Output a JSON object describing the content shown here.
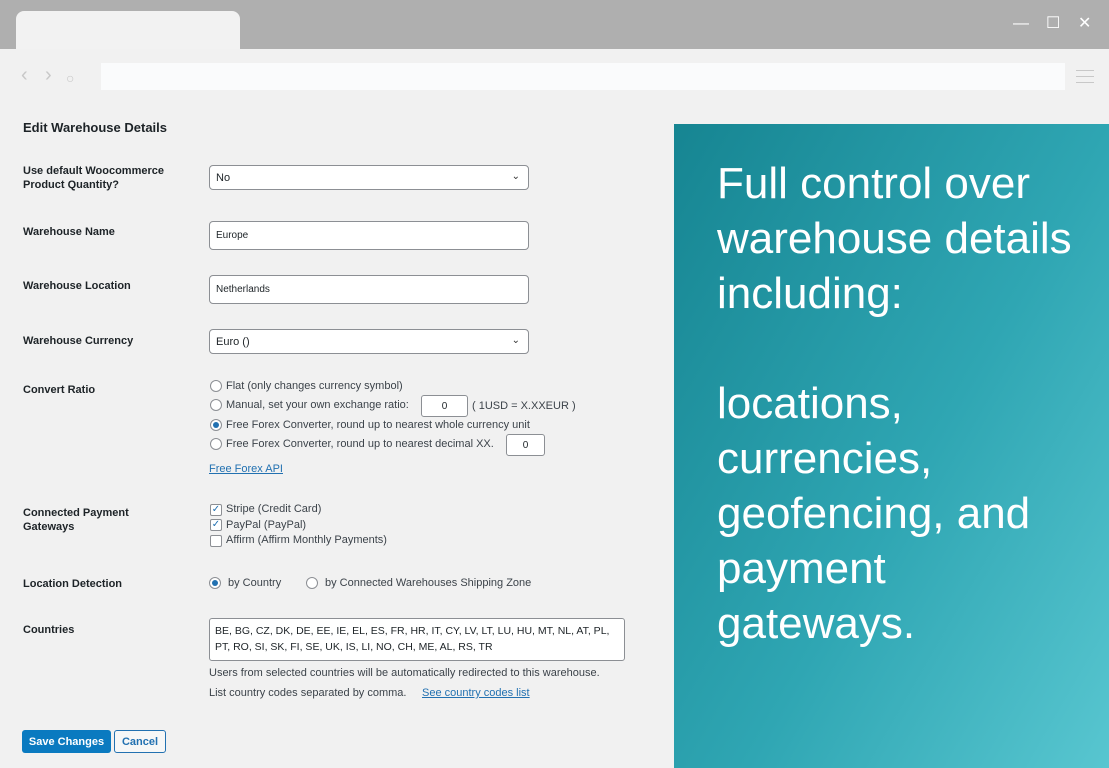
{
  "browser": {
    "minimize": "—",
    "maximize": "☐",
    "close": "✕",
    "back": "‹",
    "forward": "›",
    "reload": "○"
  },
  "form": {
    "title": "Edit Warehouse Details",
    "default_qty": {
      "label": "Use default Woocommerce Product Quantity?",
      "value": "No"
    },
    "name": {
      "label": "Warehouse Name",
      "value": "Europe"
    },
    "location": {
      "label": "Warehouse Location",
      "value": "Netherlands"
    },
    "currency": {
      "label": "Warehouse Currency",
      "value": "Euro ()"
    },
    "convert": {
      "label": "Convert Ratio",
      "options": [
        "Flat (only changes currency symbol)",
        "Manual, set your own exchange ratio:",
        "Free Forex Converter, round up to nearest whole currency unit",
        "Free Forex Converter, round up to nearest decimal XX."
      ],
      "selected": 2,
      "manual_value": "0",
      "manual_suffix": "( 1USD = X.XXEUR )",
      "decimal_value": "0",
      "api_link": "Free Forex API"
    },
    "gateways": {
      "label": "Connected Payment Gateways",
      "items": [
        {
          "label": "Stripe (Credit Card)",
          "checked": true
        },
        {
          "label": "PayPal (PayPal)",
          "checked": true
        },
        {
          "label": "Affirm (Affirm Monthly Payments)",
          "checked": false
        }
      ]
    },
    "detection": {
      "label": "Location Detection",
      "options": [
        "by Country",
        "by Connected Warehouses Shipping Zone"
      ],
      "selected": 0
    },
    "countries": {
      "label": "Countries",
      "value": "BE, BG, CZ, DK, DE, EE, IE, EL, ES, FR, HR, IT, CY, LV, LT, LU, HU, MT, NL, AT, PL, PT, RO, SI, SK, FI, SE, UK, IS, LI, NO, CH, ME, AL, RS, TR",
      "help1": "Users from selected countries will be automatically redirected to this warehouse.",
      "help2": "List country codes separated by comma.",
      "help_link": "See country codes list"
    },
    "save": "Save Changes",
    "cancel": "Cancel"
  },
  "promo": {
    "line1": "Full control over warehouse details including:",
    "line2": "locations, currencies, geofencing, and payment gateways."
  },
  "colors": {
    "accent": "#2271b1",
    "save_button": "#0a7ac0",
    "promo_start": "#168592",
    "promo_end": "#58c6d0"
  }
}
